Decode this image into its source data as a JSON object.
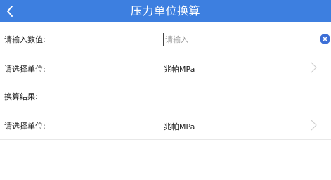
{
  "header": {
    "title": "压力单位换算",
    "back_icon": "chevron-left-icon"
  },
  "input_row": {
    "label": "请输入数值:",
    "placeholder": "请输入",
    "value": "",
    "clear_icon": "close-circle-icon"
  },
  "from_unit_row": {
    "label": "请选择单位:",
    "value": "兆帕MPa",
    "arrow_icon": "chevron-right-icon"
  },
  "result_row": {
    "label": "换算结果:"
  },
  "to_unit_row": {
    "label": "请选择单位:",
    "value": "兆帕MPa",
    "arrow_icon": "chevron-right-icon"
  },
  "colors": {
    "header_bg": "#3d7fe0",
    "clear_button": "#3d6fd6",
    "divider": "#e8e8e8"
  }
}
